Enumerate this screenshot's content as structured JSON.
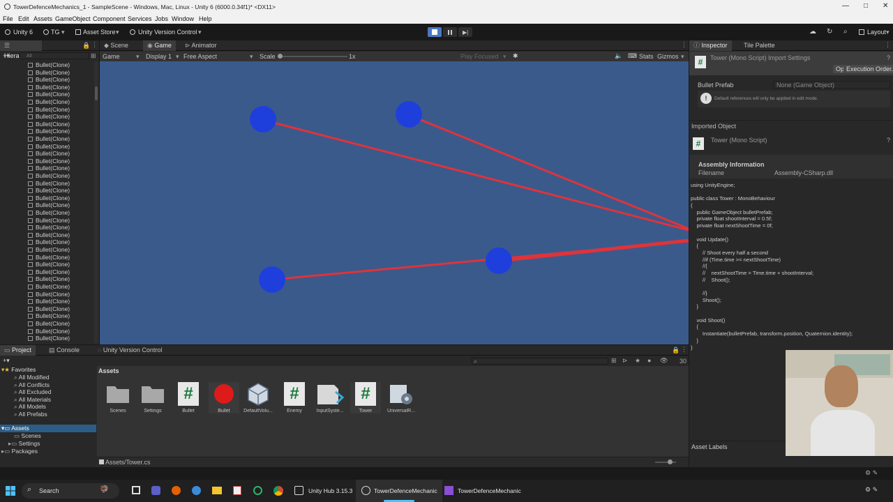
{
  "window": {
    "title": "TowerDefenceMechanics_1 - SampleScene - Windows, Mac, Linux - Unity 6 (6000.0.34f1)* <DX11>",
    "controls": [
      "—",
      "□",
      "✕"
    ]
  },
  "menu": [
    "File",
    "Edit",
    "Assets",
    "GameObject",
    "Component",
    "Services",
    "Jobs",
    "Window",
    "Help"
  ],
  "toolbar": {
    "unity_label": "Unity 6",
    "account_label": "TG",
    "asset_store_label": "Asset Store",
    "version_control_label": "Unity Version Control",
    "layout_label": "Layout"
  },
  "hierarchy": {
    "tab_label": "Hierarchy",
    "search_placeholder": "All",
    "item_label": "Bullet(Clone)",
    "items": [
      "Bullet(Clone)",
      "Bullet(Clone)",
      "Bullet(Clone)",
      "Bullet(Clone)",
      "Bullet(Clone)",
      "Bullet(Clone)",
      "Bullet(Clone)",
      "Bullet(Clone)",
      "Bullet(Clone)",
      "Bullet(Clone)",
      "Bullet(Clone)",
      "Bullet(Clone)",
      "Bullet(Clone)",
      "Bullet(Clone)",
      "Bullet(Clone)",
      "Bullet(Clone)",
      "Bullet(Clone)",
      "Bullet(Clone)",
      "Bullet(Clone)",
      "Bullet(Clone)",
      "Bullet(Clone)",
      "Bullet(Clone)",
      "Bullet(Clone)",
      "Bullet(Clone)",
      "Bullet(Clone)",
      "Bullet(Clone)",
      "Bullet(Clone)",
      "Bullet(Clone)",
      "Bullet(Clone)",
      "Bullet(Clone)",
      "Bullet(Clone)",
      "Bullet(Clone)",
      "Bullet(Clone)",
      "Bullet(Clone)",
      "Bullet(Clone)",
      "Bullet(Clone)",
      "Bullet(Clone)",
      "Bullet(Clone)"
    ]
  },
  "center_tabs": {
    "scene": "Scene",
    "game": "Game",
    "animator": "Animator"
  },
  "game_toolbar": {
    "mode": "Game",
    "display": "Display 1",
    "aspect": "Free Aspect",
    "scale_label": "Scale",
    "scale_value": "1x",
    "play_focused": "Play Focused",
    "stats": "Stats",
    "gizmos": "Gizmos"
  },
  "game_view": {
    "background": "#3a5a8c",
    "enemy_color": "#1f3fdc",
    "bullet_color": "#e0333a"
  },
  "inspector": {
    "tab_label": "Inspector",
    "tile_palette_label": "Tile Palette",
    "header_title": "Tower (Mono Script) Import Settings",
    "open_button": "Open",
    "execution_order_button": "Execution Order...",
    "field_label": "Bullet Prefab",
    "field_value": "None (Game Object)",
    "info_text": "Default references will only be applied in edit mode.",
    "imported_object_label": "Imported Object",
    "imported_object_name": "Tower (Mono Script)",
    "assembly_info_label": "Assembly Information",
    "filename_label": "Filename",
    "filename_value": "Assembly-CSharp.dll",
    "code_lines": [
      "using UnityEngine;",
      "",
      "public class Tower : MonoBehaviour",
      "{",
      "    public GameObject bulletPrefab;",
      "    private float shootInterval = 0.5f;",
      "    private float nextShootTime = 0f;",
      "",
      "    void Update()",
      "    {",
      "        // Shoot every half a second",
      "        //if (Time.time >= nextShootTime)",
      "        //{",
      "        //    nextShootTime = Time.time + shootInterval;",
      "        //    Shoot();",
      "",
      "        //}",
      "        Shoot();",
      "    }",
      "",
      "    void Shoot()",
      "    {",
      "        Instantiate(bulletPrefab, transform.position, Quaternion.identity);",
      "    }",
      "}"
    ],
    "asset_labels": "Asset Labels"
  },
  "project": {
    "tab_label": "Project",
    "console_label": "Console",
    "vc_label": "Unity Version Control",
    "favorites_label": "Favorites",
    "favorites": [
      "All Modified",
      "All Conflicts",
      "All Excluded",
      "All Materials",
      "All Models",
      "All Prefabs"
    ],
    "assets_label": "Assets",
    "folders": [
      "Scenes",
      "Settings"
    ],
    "packages_label": "Packages",
    "breadcrumb": "Assets",
    "assets": [
      "Scenes",
      "Settings",
      "Bullet",
      "Bullet",
      "DefaultVolu...",
      "Enemy",
      "InputSyste...",
      "Tower",
      "UniversalR..."
    ],
    "footer_path": "Assets/Tower.cs",
    "hidden_count": "30"
  },
  "taskbar": {
    "search_label": "Search",
    "unity_hub_label": "Unity Hub 3.15.3",
    "editor_label": "TowerDefenceMechanic",
    "vs_label": "TowerDefenceMechanic"
  }
}
